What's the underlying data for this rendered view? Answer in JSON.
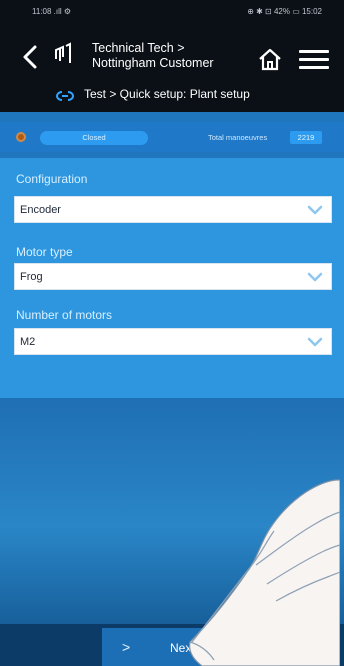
{
  "status_bar": {
    "left": "11:08 .ıll ⚙",
    "right": "⊕ ✱ ⊡ 42% ▭ 15:02"
  },
  "header": {
    "title_line1": "Technical Tech >",
    "title_line2": "Nottingham Customer",
    "subtitle": "Test > Quick setup: Plant setup"
  },
  "status_row": {
    "pill_label": "Closed",
    "total_label": "Total manoeuvres",
    "total_value": "2219"
  },
  "form": {
    "configuration_label": "Configuration",
    "configuration_value": "Encoder",
    "motor_type_label": "Motor type",
    "motor_type_value": "Frog",
    "motors_label": "Number of motors",
    "motors_value": "M2"
  },
  "footer": {
    "next_arrow": ">",
    "next_label": "Next"
  }
}
